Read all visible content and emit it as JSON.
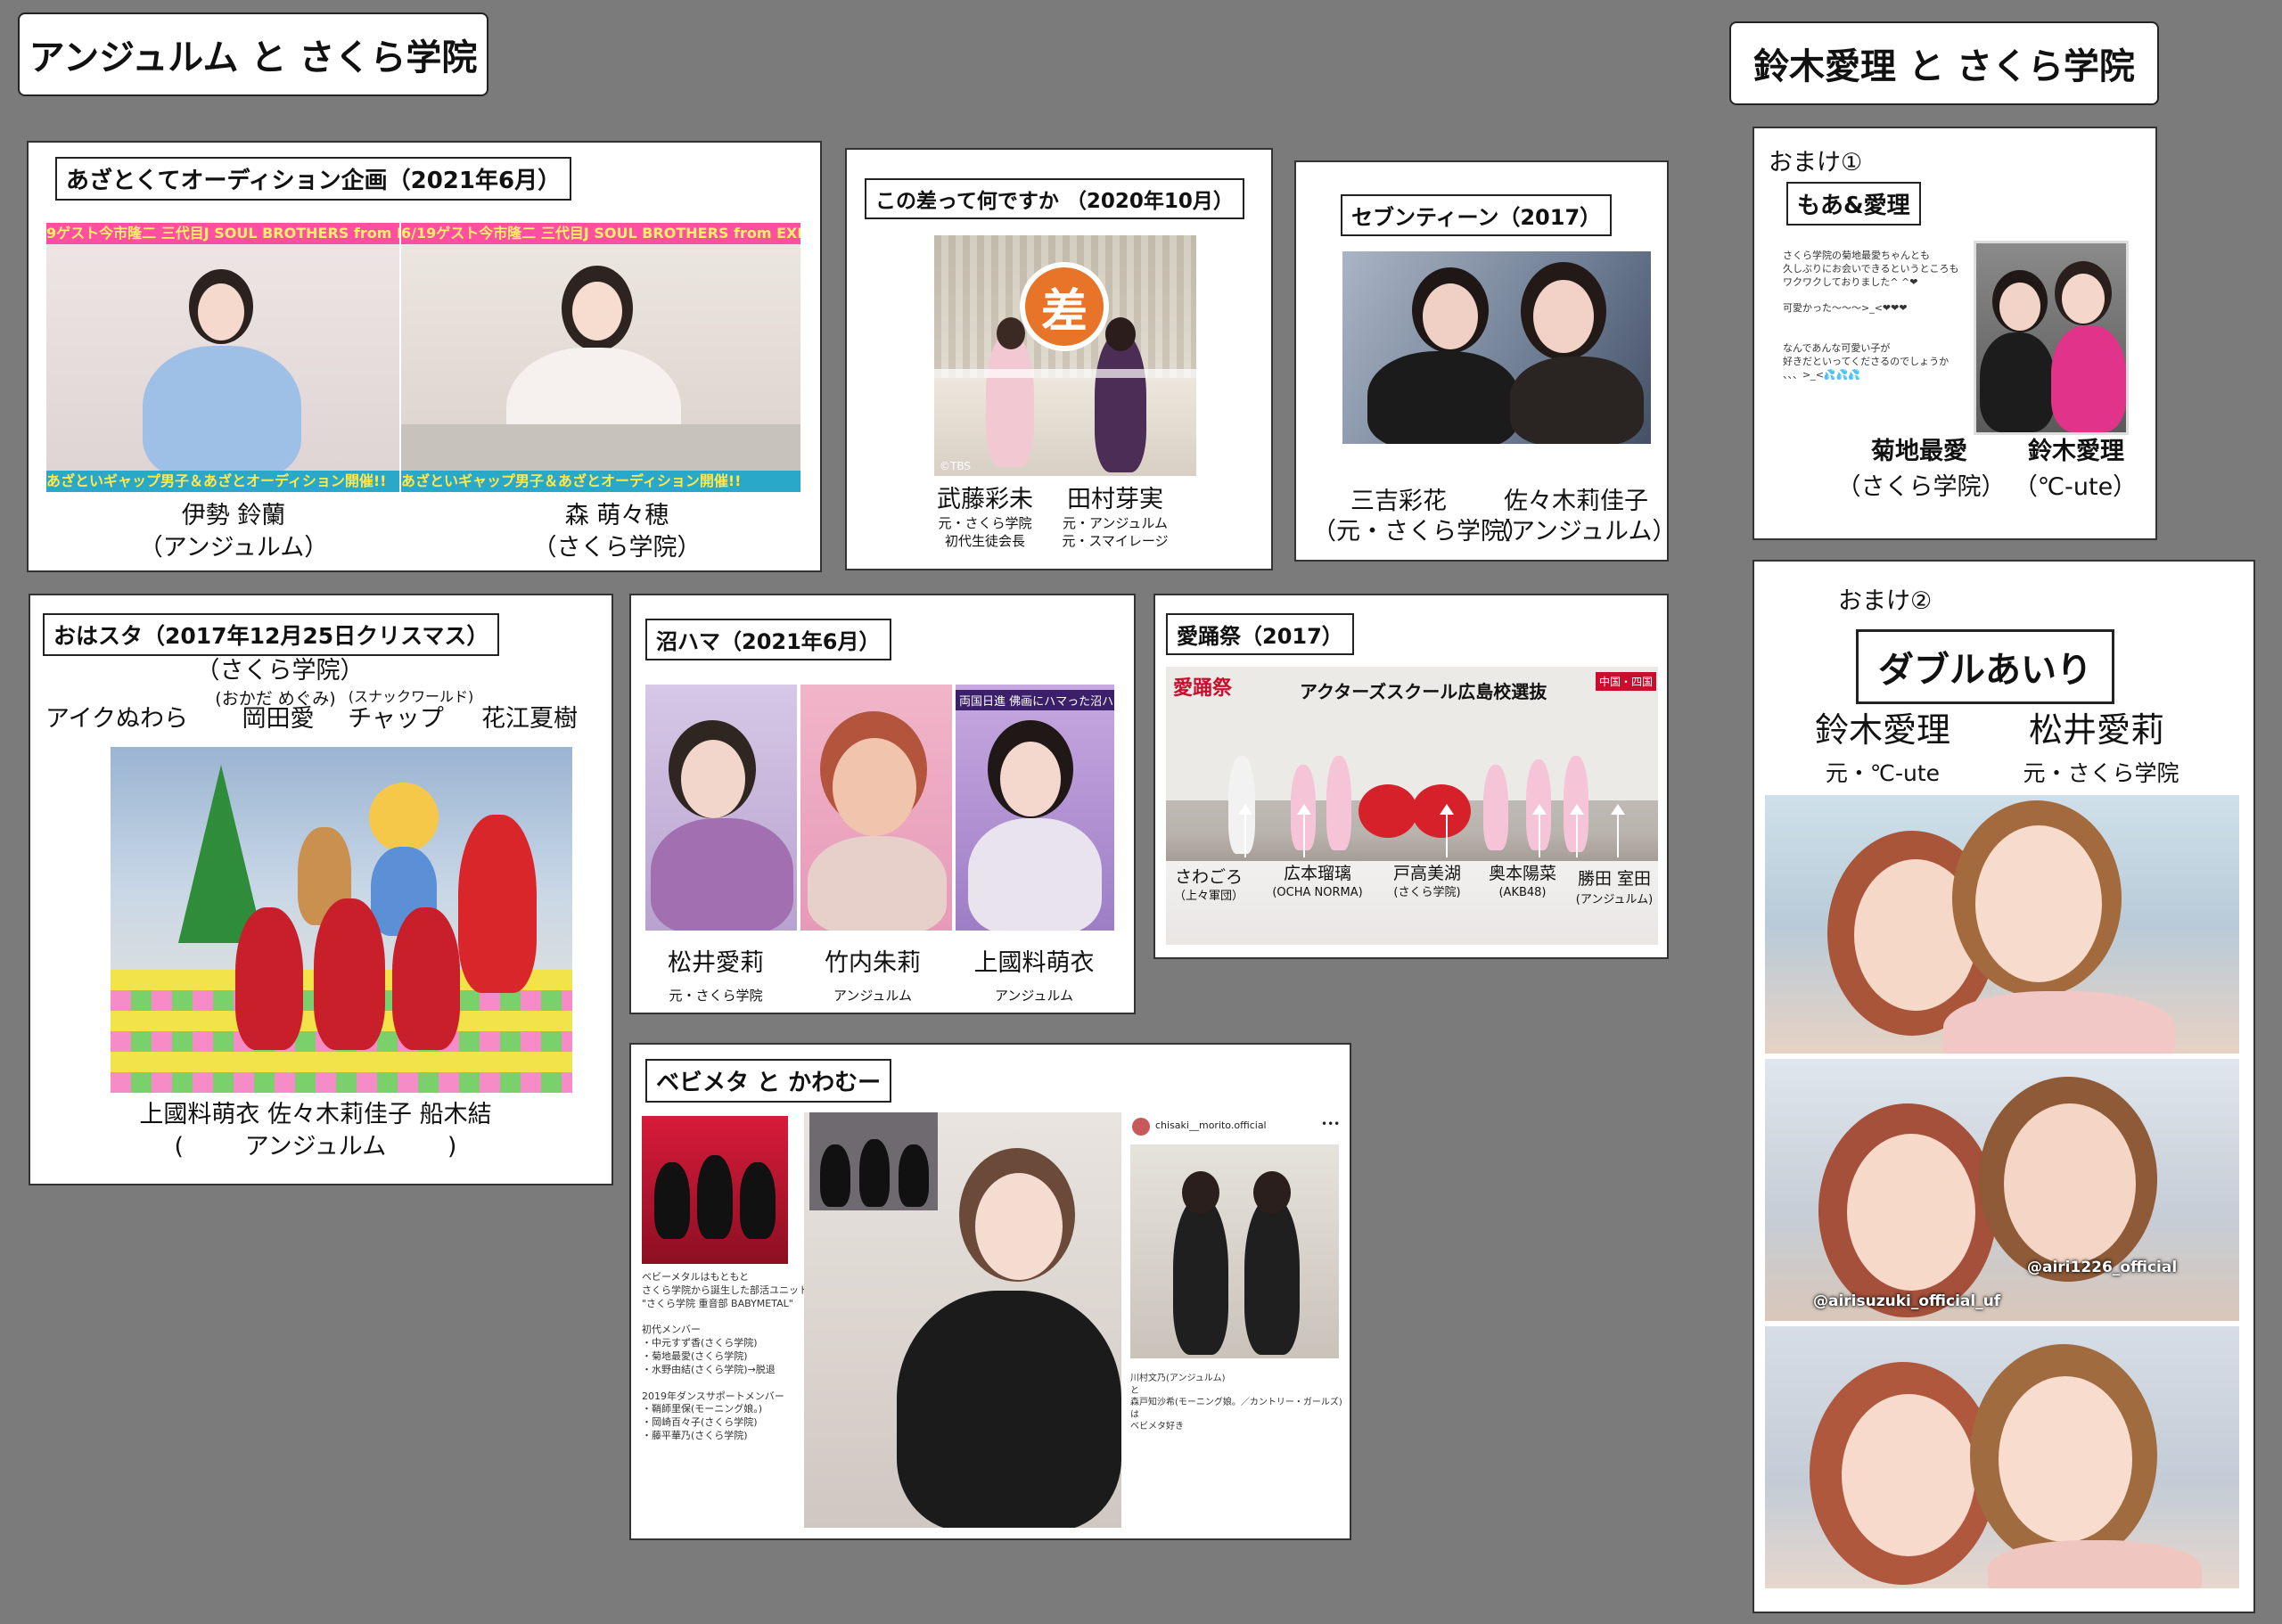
{
  "header": {
    "left_title": "アンジュルム と さくら学院",
    "right_title": "鈴木愛理 と さくら学院"
  },
  "panel_azato": {
    "title": "あざとくてオーディション企画（2021年6月）",
    "banner_top_1": "9ゲスト今市隆二 三代目J SOUL BROTHERS from EXI",
    "banner_top_2": "6/19ゲスト今市隆二 三代目J SOUL BROTHERS from EXI",
    "banner_bottom_1": "あざといギャップ男子＆あざとオーディション開催!!",
    "banner_bottom_2": "あざといギャップ男子＆あざとオーディション開催!!",
    "person1_name": "伊勢 鈴蘭",
    "person1_group": "（アンジュルム）",
    "person2_name": "森 萌々穂",
    "person2_group": "（さくら学院）"
  },
  "panel_sa": {
    "title": "この差って何ですか （2020年10月）",
    "logo_char": "差",
    "tbs": "©TBS",
    "person1_name": "武藤彩未",
    "person1_sub1": "元・さくら学院",
    "person1_sub2": "初代生徒会長",
    "person2_name": "田村芽実",
    "person2_sub1": "元・アンジュルム",
    "person2_sub2": "元・スマイレージ"
  },
  "panel_seventeen": {
    "title": "セブンティーン（2017）",
    "person1_name": "三吉彩花",
    "person1_group": "（元・さくら学院）",
    "person2_name": "佐々木莉佳子",
    "person2_group": "（アンジュルム）"
  },
  "panel_omake1": {
    "label": "おまけ①",
    "subtitle": "もあ&愛理",
    "post_text": "さくら学院の菊地最愛ちゃんとも\n久しぶりにお会いできるというところも\nワクワクしておりました^ ^❤\n\n可愛かった〜〜〜>_<❤❤❤\n\n\nなんであんな可愛い子が\n好きだといってくださるのでしょうか\n、、、>_<💦💦💦",
    "person1_name": "菊地最愛",
    "person1_group": "（さくら学院）",
    "person2_name": "鈴木愛理",
    "person2_group": "（℃-ute）"
  },
  "panel_ohasuta": {
    "title": "おはスタ（2017年12月25日クリスマス）",
    "group_top": "（さくら学院）",
    "reading_okada": "(おかだ めぐみ)",
    "reading_chappu": "(スナックワールド)",
    "top_name_1": "アイクぬわら",
    "top_name_2": "岡田愛",
    "top_name_3": "チャップ",
    "top_name_4": "花江夏樹",
    "bottom_names": "上國料萌衣  佐々木莉佳子  船木結",
    "bottom_group": "(        アンジュルム        )"
  },
  "panel_numahama": {
    "title": "沼ハマ（2021年6月）",
    "caption_strip": "両国日進 佛画にハマった沼ハマ子",
    "person1_name": "松井愛莉",
    "person1_sub": "元・さくら学院",
    "person2_name": "竹内朱莉",
    "person2_sub": "アンジュルム",
    "person3_name": "上國料萌衣",
    "person3_sub": "アンジュルム"
  },
  "panel_aiyousai": {
    "title": "愛踊祭（2017）",
    "caption": "アクターズスクール広島校選抜",
    "logo": "愛踊祭",
    "region": "中国・四国",
    "labels": [
      {
        "name": "さわごろ",
        "sub": "（上々軍団）"
      },
      {
        "name": "広本瑠璃",
        "sub": "(OCHA NORMA)"
      },
      {
        "name": "戸高美湖",
        "sub": "(さくら学院)"
      },
      {
        "name": "奥本陽菜",
        "sub": "(AKB48)"
      },
      {
        "name": "勝田 室田",
        "sub": "(アンジュルム)"
      }
    ]
  },
  "panel_babymetal": {
    "title": "ベビメタ と かわむー",
    "description": "ベビーメタルはもともと\nさくら学院から誕生した部活ユニット\n\"さくら学院 重音部 BABYMETAL\"\n\n初代メンバー\n・中元すず香(さくら学院)\n・菊地最愛(さくら学院)\n・水野由結(さくら学院)→脱退\n\n2019年ダンスサポートメンバー\n・鞘師里保(モーニング娘。)\n・岡崎百々子(さくら学院)\n・藤平華乃(さくら学院)",
    "account": "chisaki__morito.official",
    "more": "•••",
    "insta_caption": "川村文乃(アンジュルム)\nと\n森戸知沙希(モーニング娘。／カントリー・ガールズ)\nは\nベビメタ好き"
  },
  "panel_omake2": {
    "label": "おまけ②",
    "subtitle": "ダブルあいり",
    "person1_name": "鈴木愛理",
    "person1_sub": "元・℃-ute",
    "person2_name": "松井愛莉",
    "person2_sub": "元・さくら学院",
    "tag1": "@airi1226_official",
    "tag2": "@airisuzuki_official_uf"
  },
  "colors": {
    "background": "#7b7b7b",
    "azato_banner_top": "#ff4fa0",
    "azato_banner_bottom": "#2aa8c9",
    "sa_logo": "#e8742a"
  }
}
